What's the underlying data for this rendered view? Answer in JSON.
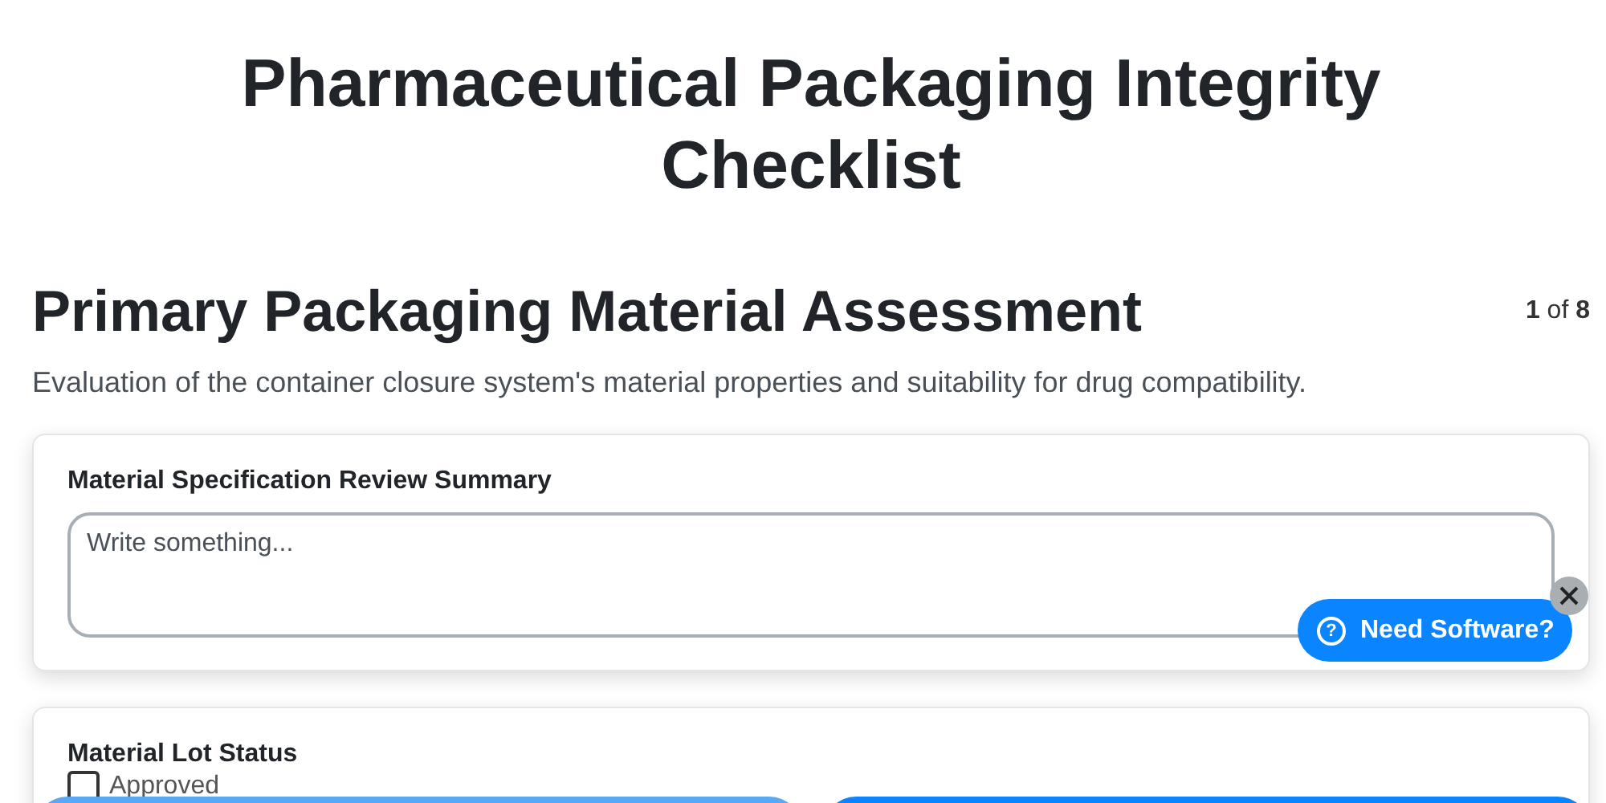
{
  "title": "Pharmaceutical Packaging Integrity Checklist",
  "section": {
    "heading": "Primary Packaging Material Assessment",
    "counter": "**1** of **8**",
    "description": "Evaluation of the container closure system's material properties and suitability for drug compatibility."
  },
  "fields": [
    {
      "kind": "textarea",
      "label": "Material Specification Review Summary",
      "placeholder": "Write something..."
    },
    {
      "kind": "checkboxes",
      "label": "Material Lot Status",
      "options": [
        {
          "label": "Approved",
          "checked": false
        }
      ]
    }
  ],
  "help_button": {
    "label": "Need Software?",
    "icon": "?"
  },
  "footer_buttons": [
    {
      "kind": "secondary"
    },
    {
      "kind": "primary"
    }
  ]
}
